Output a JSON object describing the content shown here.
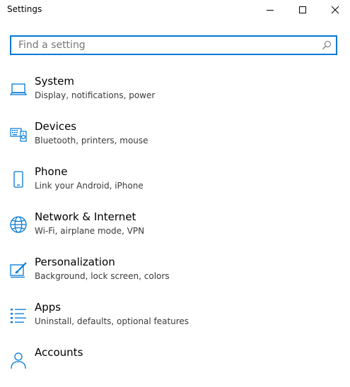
{
  "window": {
    "title": "Settings",
    "minimize_label": "Minimize",
    "maximize_label": "Maximize",
    "close_label": "Close"
  },
  "search": {
    "placeholder": "Find a setting",
    "value": ""
  },
  "categories": [
    {
      "name": "System",
      "description": "Display, notifications, power",
      "icon": "laptop-icon"
    },
    {
      "name": "Devices",
      "description": "Bluetooth, printers, mouse",
      "icon": "devices-icon"
    },
    {
      "name": "Phone",
      "description": "Link your Android, iPhone",
      "icon": "phone-icon"
    },
    {
      "name": "Network & Internet",
      "description": "Wi-Fi, airplane mode, VPN",
      "icon": "globe-icon"
    },
    {
      "name": "Personalization",
      "description": "Background, lock screen, colors",
      "icon": "paint-icon"
    },
    {
      "name": "Apps",
      "description": "Uninstall, defaults, optional features",
      "icon": "apps-list-icon"
    },
    {
      "name": "Accounts",
      "description": "",
      "icon": "person-icon"
    }
  ],
  "colors": {
    "accent": "#0078d7",
    "icon": "#0078d7",
    "text": "#000000",
    "secondary_text": "#3a3a3a"
  }
}
